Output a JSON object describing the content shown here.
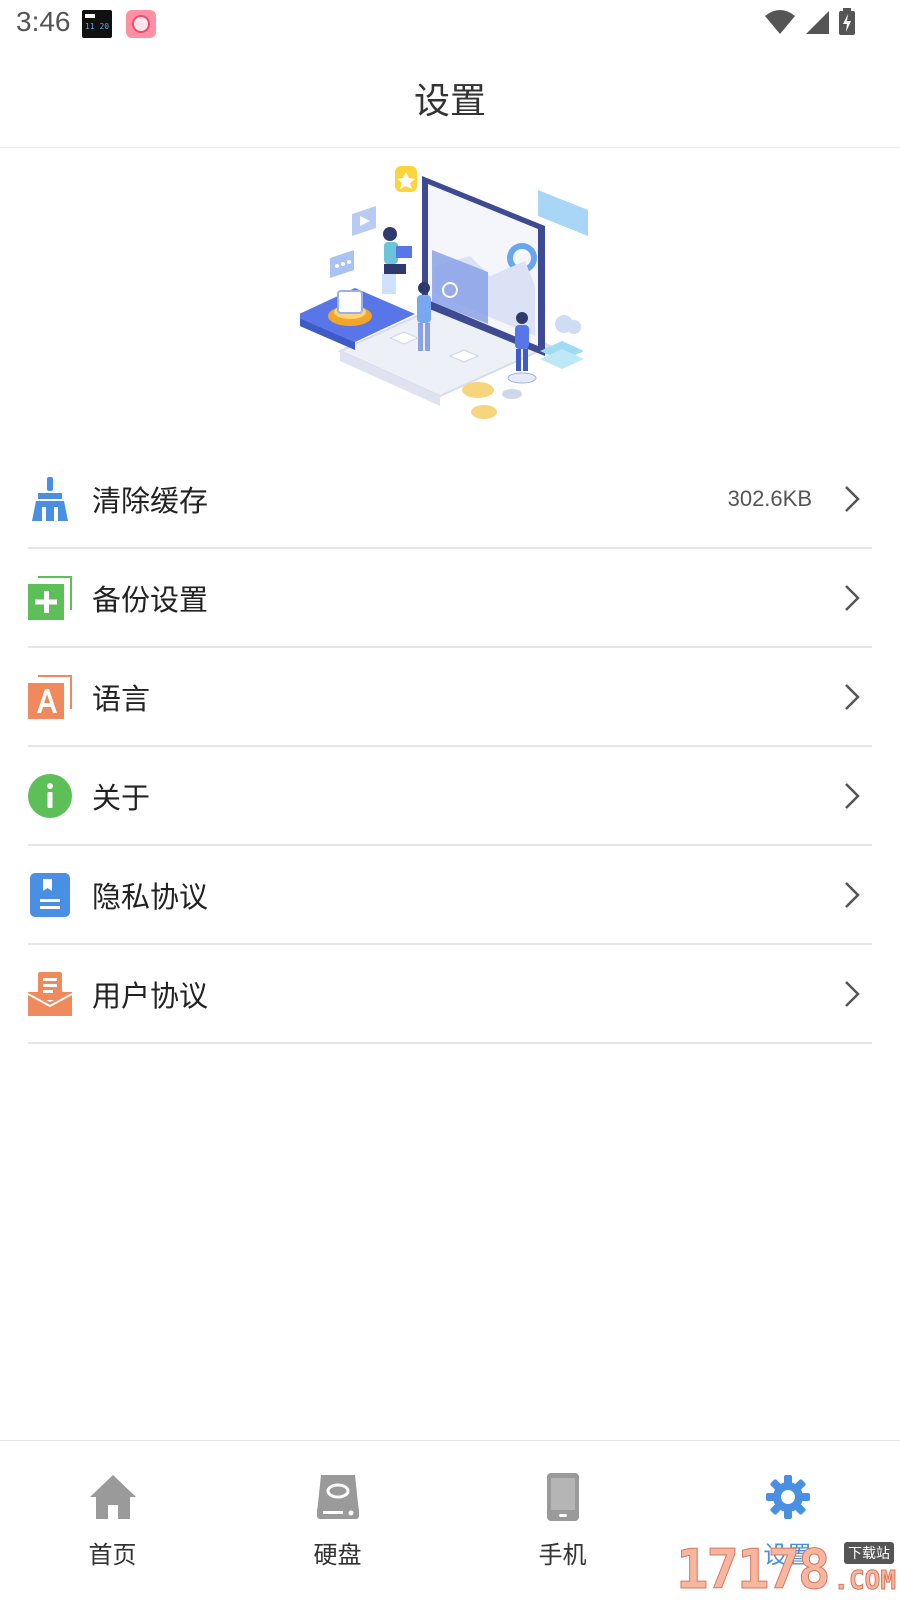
{
  "status_bar": {
    "time": "3:46",
    "app_icons": [
      "clock-widget-icon",
      "app-notification-icon"
    ],
    "system_icons": [
      "wifi-icon",
      "cellular-signal-icon",
      "battery-charging-icon"
    ]
  },
  "header": {
    "title": "设置"
  },
  "settings": {
    "items": [
      {
        "label": "清除缓存",
        "value": "302.6KB",
        "icon": "broom-icon",
        "icon_color": "#4a90e2"
      },
      {
        "label": "备份设置",
        "value": "",
        "icon": "backup-plus-icon",
        "icon_color": "#5cbf58"
      },
      {
        "label": "语言",
        "value": "",
        "icon": "language-icon",
        "icon_color": "#f08a5d"
      },
      {
        "label": "关于",
        "value": "",
        "icon": "info-icon",
        "icon_color": "#5cbf58"
      },
      {
        "label": "隐私协议",
        "value": "",
        "icon": "privacy-document-icon",
        "icon_color": "#4a90e2"
      },
      {
        "label": "用户协议",
        "value": "",
        "icon": "user-agreement-icon",
        "icon_color": "#f08a5d"
      }
    ]
  },
  "bottom_nav": {
    "items": [
      {
        "label": "首页",
        "icon": "home-icon",
        "active": false
      },
      {
        "label": "硬盘",
        "icon": "hard-disk-icon",
        "active": false
      },
      {
        "label": "手机",
        "icon": "phone-icon",
        "active": false
      },
      {
        "label": "设置",
        "icon": "gear-icon",
        "active": true
      }
    ],
    "inactive_color": "#9a9a9a",
    "active_color": "#4a90e2"
  },
  "watermark": {
    "digits": "17178",
    "tag": "下载站",
    "suffix": ".COM"
  }
}
